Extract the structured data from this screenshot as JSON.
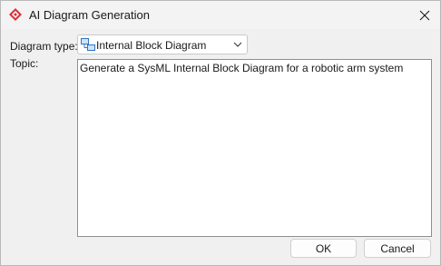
{
  "window": {
    "title": "AI Diagram Generation",
    "app_icon": "app-logo-icon",
    "close_icon": "close-icon"
  },
  "form": {
    "diagram_type_label": "Diagram type:",
    "diagram_type_value": "Internal Block Diagram",
    "diagram_type_icon": "internal-block-diagram-icon",
    "topic_label": "Topic:",
    "topic_value": "Generate a SysML Internal Block Diagram for a robotic arm system"
  },
  "buttons": {
    "ok_label": "OK",
    "cancel_label": "Cancel"
  },
  "colors": {
    "app_icon_red": "#d9343f",
    "diagram_icon_blue": "#2f74c0"
  }
}
